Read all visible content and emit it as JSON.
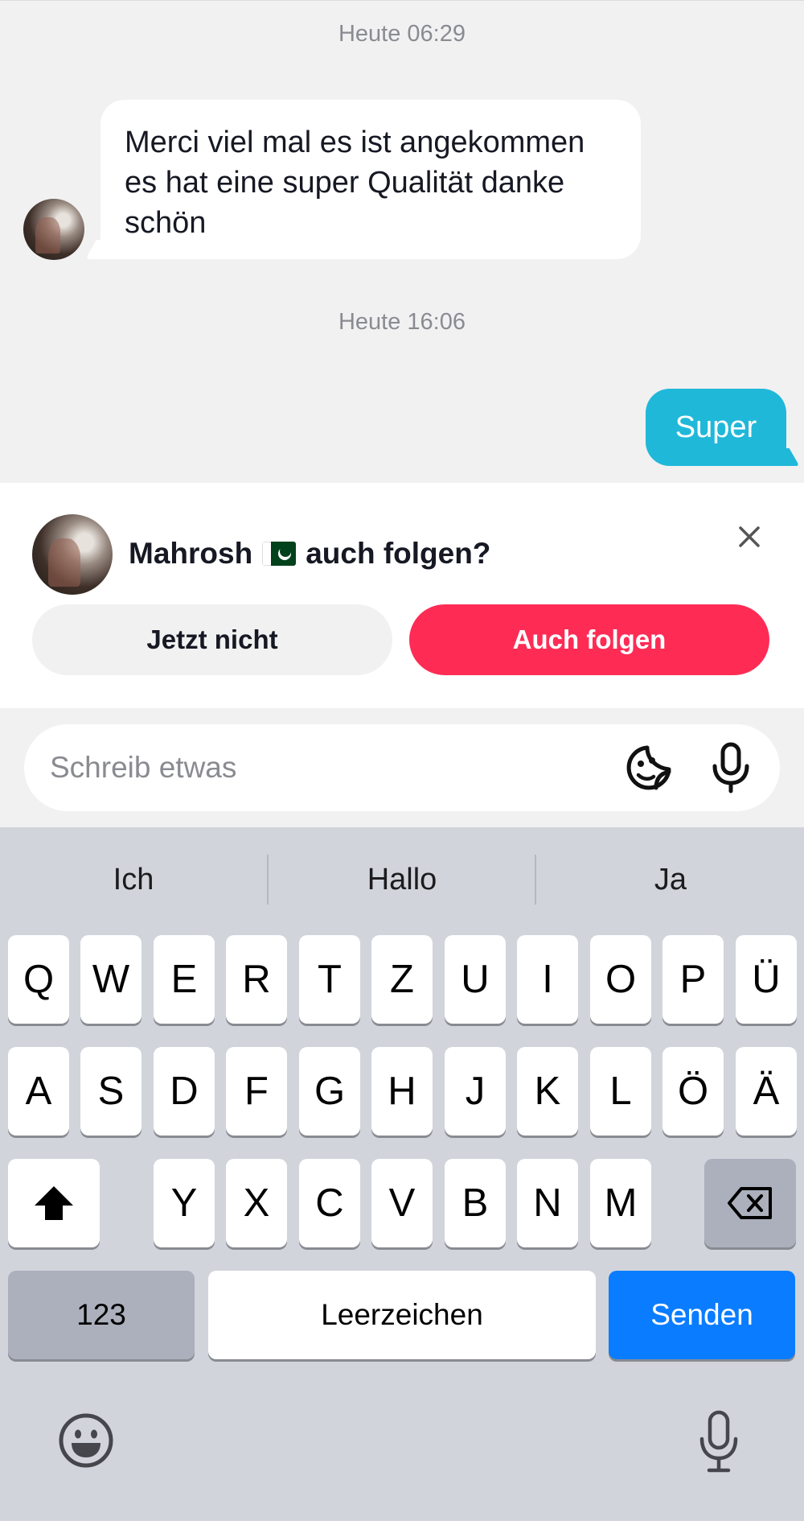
{
  "chat": {
    "timestamp_1": "Heute 06:29",
    "incoming_message": "Merci viel mal es ist angekommen es hat eine super Qualität danke schön",
    "timestamp_2": "Heute 16:06",
    "outgoing_message": "Super"
  },
  "follow_prompt": {
    "name": "Mahrosh",
    "flag_icon": "pakistan-flag",
    "suffix": "auch folgen?",
    "not_now_label": "Jetzt nicht",
    "follow_label": "Auch folgen",
    "colors": {
      "follow": "#fe2c55",
      "not_now": "#f1f1f2"
    }
  },
  "composer": {
    "placeholder": "Schreib etwas",
    "value": "",
    "icons": [
      "sticker-icon",
      "microphone-icon"
    ]
  },
  "keyboard": {
    "suggestions": [
      "Ich",
      "Hallo",
      "Ja"
    ],
    "row1": [
      "Q",
      "W",
      "E",
      "R",
      "T",
      "Z",
      "U",
      "I",
      "O",
      "P",
      "Ü"
    ],
    "row2": [
      "A",
      "S",
      "D",
      "F",
      "G",
      "H",
      "J",
      "K",
      "L",
      "Ö",
      "Ä"
    ],
    "row3": [
      "Y",
      "X",
      "C",
      "V",
      "B",
      "N",
      "M"
    ],
    "numbers_label": "123",
    "space_label": "Leerzeichen",
    "send_label": "Senden",
    "send_color": "#0a7cff",
    "icons": [
      "shift-icon",
      "backspace-icon",
      "emoji-icon",
      "dictation-mic-icon"
    ]
  },
  "colors": {
    "outgoing_bubble": "#20b8d9",
    "background": "#f1f1f2",
    "keyboard": "#d1d4db"
  }
}
